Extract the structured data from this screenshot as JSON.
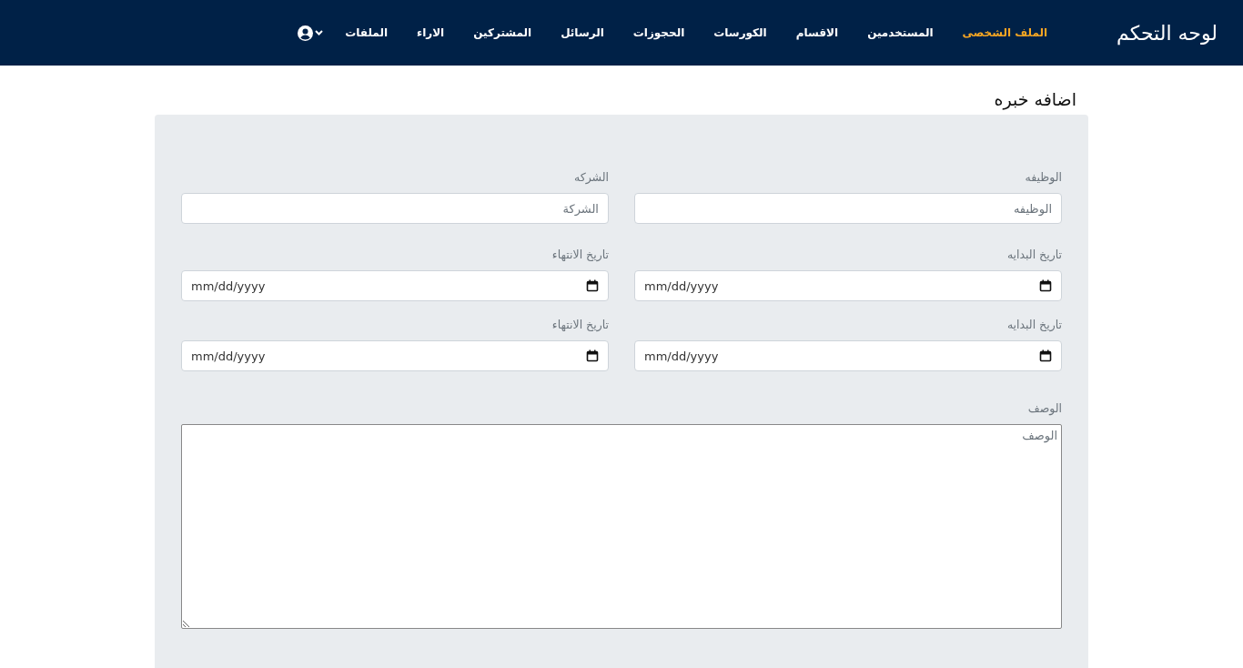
{
  "navbar": {
    "brand": "لوحه التحكم",
    "items": [
      {
        "label": "الملف الشخصى",
        "selected": true
      },
      {
        "label": "المستخدمين",
        "selected": false
      },
      {
        "label": "الاقسام",
        "selected": false
      },
      {
        "label": "الكورسات",
        "selected": false
      },
      {
        "label": "الحجوزات",
        "selected": false
      },
      {
        "label": "الرسائل",
        "selected": false
      },
      {
        "label": "المشتركين",
        "selected": false
      },
      {
        "label": "الاراء",
        "selected": false
      },
      {
        "label": "الملفات",
        "selected": false
      }
    ]
  },
  "page_title": "اضافه خبره",
  "form": {
    "fields": [
      {
        "kind": "text",
        "label": "الوظيفه",
        "placeholder": "الوظيفه"
      },
      {
        "kind": "text",
        "label": "الشركه",
        "placeholder": "الشركة"
      },
      {
        "kind": "date",
        "label": "تاريخ البدايه",
        "value": "mm/dd/yyyy"
      },
      {
        "kind": "date",
        "label": "تاريخ الانتهاء",
        "value": "mm/dd/yyyy"
      },
      {
        "kind": "date",
        "label": "تاريخ البدايه",
        "value": "mm/dd/yyyy"
      },
      {
        "kind": "date",
        "label": "تاريخ الانتهاء",
        "value": "mm/dd/yyyy"
      },
      {
        "kind": "textarea",
        "label": "الوصف",
        "placeholder": "الوصف"
      }
    ]
  }
}
